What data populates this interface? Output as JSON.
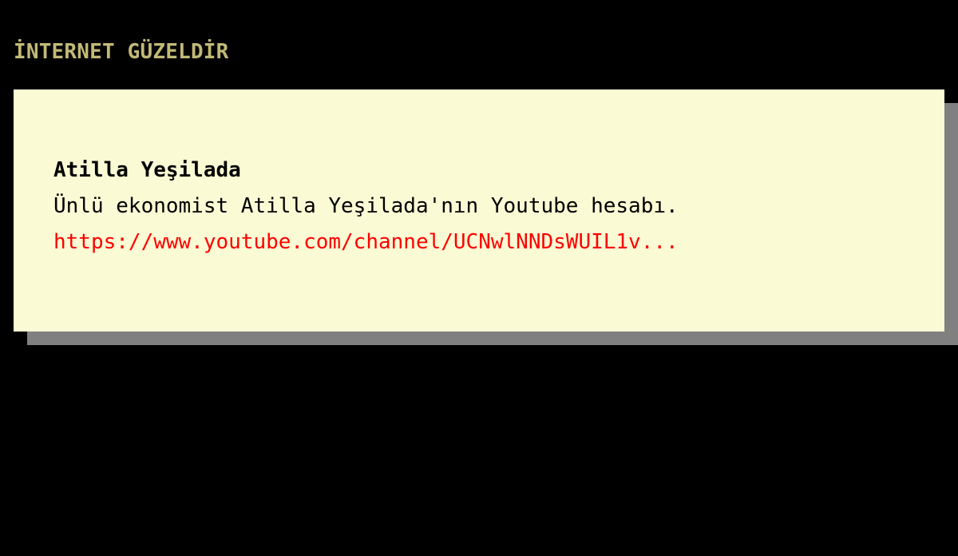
{
  "header": {
    "site_title": "İNTERNET GÜZELDİR"
  },
  "entry": {
    "title": "Atilla Yeşilada",
    "description": "Ünlü ekonomist Atilla Yeşilada'nın Youtube hesabı.",
    "link_text": "https://www.youtube.com/channel/UCNwlNNDsWUIL1v..."
  },
  "colors": {
    "background": "#000000",
    "title_color": "#c2b977",
    "card_background": "#fafad4",
    "card_shadow": "#808080",
    "link_color": "#ff0000"
  }
}
